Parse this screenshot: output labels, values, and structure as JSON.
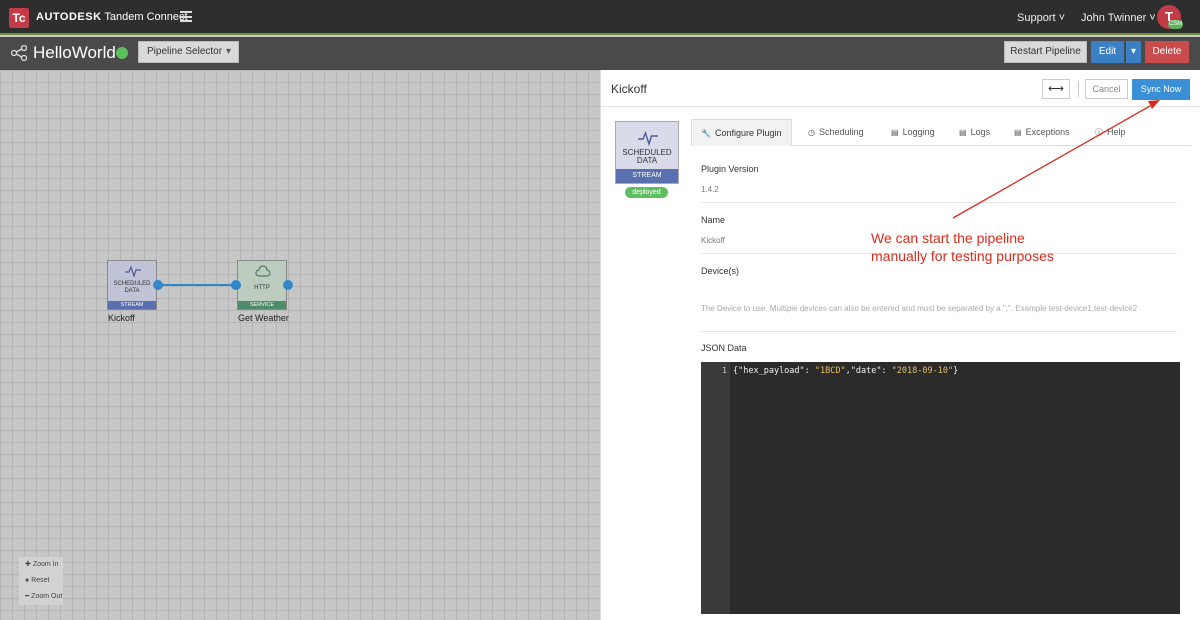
{
  "app": {
    "logo_letter": "Tc",
    "brand_bold": "AUTODESK",
    "brand_name": "Tandem Connect",
    "support": "Support ˅",
    "user": "John Twinner ˅",
    "avatar_letter": "T",
    "avatar_badge": "CSM"
  },
  "pipeline": {
    "title": "HelloWorld",
    "selector_label": "Pipeline Selector",
    "restart_label": "Restart Pipeline",
    "edit_label": "Edit",
    "caret": "▾",
    "delete_label": "Delete"
  },
  "canvas": {
    "nodes": [
      {
        "type_text": "SCHEDULED DATA",
        "category": "STREAM",
        "label": "Kickoff"
      },
      {
        "type_text": "HTTP",
        "category": "SERVICE",
        "label": "Get Weather"
      }
    ],
    "zoom_in": "Zoom In",
    "reset": "Reset",
    "zoom_out": "Zoom Out"
  },
  "panel": {
    "title": "Kickoff",
    "expand_icon": "⟷",
    "cancel_label": "Cancel",
    "sync_label": "Sync Now",
    "plugin_card": {
      "line1": "SCHEDULED",
      "line2": "DATA",
      "category": "STREAM",
      "status": "deployed"
    },
    "tabs": [
      {
        "icon": "wrench-icon",
        "glyph": "🔧",
        "label": "Configure Plugin"
      },
      {
        "icon": "clock-icon",
        "glyph": "◷",
        "label": "Scheduling"
      },
      {
        "icon": "document-icon",
        "glyph": "▤",
        "label": "Logging"
      },
      {
        "icon": "document-icon",
        "glyph": "▤",
        "label": "Logs"
      },
      {
        "icon": "document-icon",
        "glyph": "▤",
        "label": "Exceptions"
      },
      {
        "icon": "help-icon",
        "glyph": "ⓘ",
        "label": "Help"
      }
    ],
    "fields": {
      "plugin_version_label": "Plugin Version",
      "plugin_version": "1.4.2",
      "name_label": "Name",
      "name": "Kickoff",
      "devices_label": "Device(s)",
      "devices_hint": "The Device to use. Multiple devices can also be entered and must be separated by a \",\". Example test-device1,test-device2",
      "json_label": "JSON Data"
    },
    "editor": {
      "line_number": "1",
      "code_open": "{\"hex_payload\": ",
      "code_v1": "\"1BCD\"",
      "code_mid": ",\"date\": ",
      "code_v2": "\"2018-09-10\"",
      "code_close": "}"
    }
  },
  "annotation": {
    "line1": "We can start the pipeline",
    "line2": "manually for testing purposes",
    "color": "#d42d1e"
  },
  "colors": {
    "topbar": "#2e2e2e",
    "accent_blue": "#3a8fd6",
    "delete_red": "#c94b4b",
    "status_green": "#5dbf5d"
  }
}
